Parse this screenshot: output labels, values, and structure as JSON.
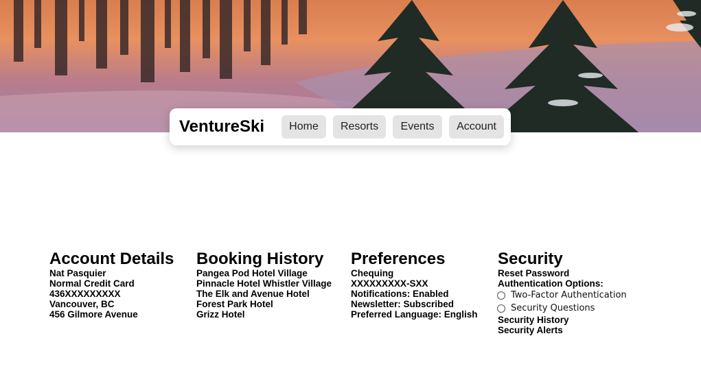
{
  "brand": "VentureSki",
  "nav": {
    "home": "Home",
    "resorts": "Resorts",
    "events": "Events",
    "account": "Account"
  },
  "account_details": {
    "title": "Account Details",
    "name": "Nat Pasquier",
    "card_type": "Normal Credit Card",
    "card_number": "436XXXXXXXXX",
    "city": "Vancouver, BC",
    "address": "456 Gilmore Avenue"
  },
  "booking_history": {
    "title": "Booking History",
    "items": [
      "Pangea Pod Hotel Village",
      "Pinnacle Hotel Whistler Village",
      "The Elk and Avenue Hotel",
      "Forest Park Hotel",
      "Grizz Hotel"
    ]
  },
  "preferences": {
    "title": "Preferences",
    "account_type": "Chequing",
    "account_number": "XXXXXXXXX-SXX",
    "notifications": "Notifications: Enabled",
    "newsletter": "Newsletter: Subscribed",
    "language": "Preferred Language: English"
  },
  "security": {
    "title": "Security",
    "reset_password": "Reset Password",
    "auth_options_label": "Authentication Options:",
    "option_two_factor": "Two-Factor Authentication",
    "option_questions": "Security Questions",
    "history": "Security History",
    "alerts": "Security Alerts"
  }
}
